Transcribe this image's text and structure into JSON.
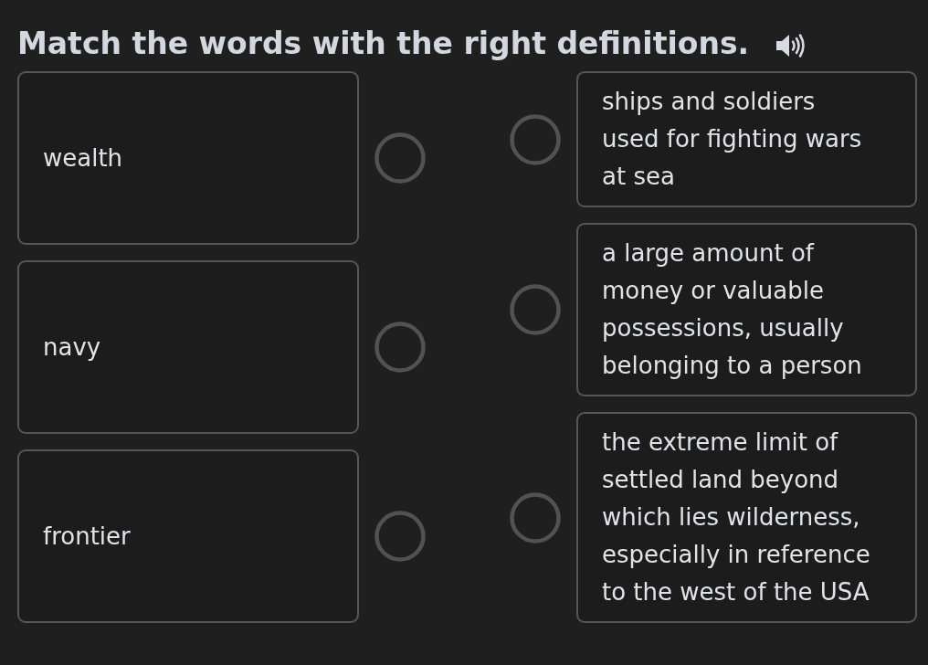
{
  "title": "Match the words with the right definitions.",
  "words": [
    {
      "text": "wealth"
    },
    {
      "text": "navy"
    },
    {
      "text": "frontier"
    }
  ],
  "definitions": [
    {
      "text": "ships and soldiers used for fighting wars at sea"
    },
    {
      "text": "a large amount of money or valuable possessions, usually belonging to a person"
    },
    {
      "text": "the extreme limit of settled land beyond which lies wilderness, especially in reference to the west of the USA"
    }
  ]
}
